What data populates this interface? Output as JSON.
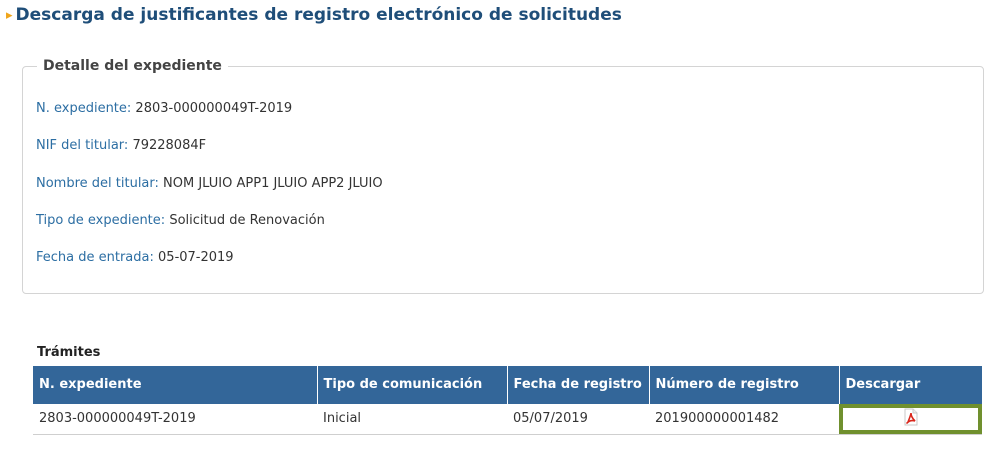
{
  "header": {
    "title": "Descarga de justificantes de registro electrónico de solicitudes",
    "bullet_icon": "chevron-right-icon"
  },
  "detail": {
    "legend": "Detalle del expediente",
    "fields": [
      {
        "label": "N. expediente:",
        "value": "2803-000000049T-2019"
      },
      {
        "label": "NIF del titular:",
        "value": "79228084F"
      },
      {
        "label": "Nombre del titular:",
        "value": "NOM JLUIO APP1 JLUIO APP2 JLUIO"
      },
      {
        "label": "Tipo de expediente:",
        "value": "Solicitud de Renovación"
      },
      {
        "label": "Fecha de entrada:",
        "value": "05-07-2019"
      }
    ]
  },
  "tramites": {
    "title": "Trámites",
    "columns": [
      "N. expediente",
      "Tipo de comunicación",
      "Fecha de registro",
      "Número de registro",
      "Descargar"
    ],
    "rows": [
      {
        "expediente": "2803-000000049T-2019",
        "tipo": "Inicial",
        "fecha": "05/07/2019",
        "numero": "201900000001482",
        "download_icon": "pdf-icon"
      }
    ]
  },
  "colors": {
    "title": "#1f4e79",
    "label": "#2c6ea3",
    "table_header": "#336699",
    "highlight": "#70902e",
    "bullet": "#f0a51a"
  }
}
